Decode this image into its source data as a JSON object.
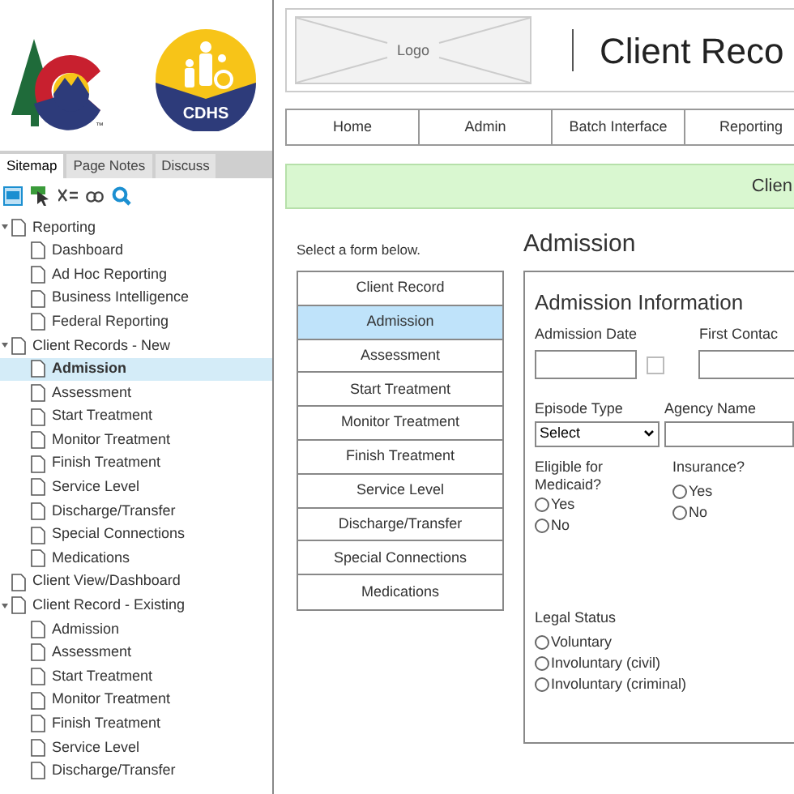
{
  "sidebar": {
    "logo_text": "CDHS",
    "trademark": "™",
    "tabs": [
      {
        "label": "Sitemap",
        "selected": true
      },
      {
        "label": "Page Notes",
        "selected": false
      },
      {
        "label": "Discuss",
        "selected": false
      }
    ],
    "tree": [
      {
        "label": "Reporting",
        "selected": false,
        "expanded": true,
        "children": [
          {
            "label": "Dashboard",
            "selected": false
          },
          {
            "label": "Ad Hoc Reporting",
            "selected": false
          },
          {
            "label": "Business Intelligence",
            "selected": false
          },
          {
            "label": "Federal Reporting",
            "selected": false
          }
        ]
      },
      {
        "label": "Client Records - New",
        "selected": false,
        "expanded": true,
        "children": [
          {
            "label": "Admission",
            "selected": true
          },
          {
            "label": "Assessment",
            "selected": false
          },
          {
            "label": "Start Treatment",
            "selected": false
          },
          {
            "label": "Monitor Treatment",
            "selected": false
          },
          {
            "label": "Finish Treatment",
            "selected": false
          },
          {
            "label": "Service Level",
            "selected": false
          },
          {
            "label": "Discharge/Transfer",
            "selected": false
          },
          {
            "label": "Special Connections",
            "selected": false
          },
          {
            "label": "Medications",
            "selected": false
          }
        ]
      },
      {
        "label": "Client View/Dashboard",
        "selected": false,
        "expanded": false
      },
      {
        "label": "Client Record - Existing",
        "selected": false,
        "expanded": true,
        "children": [
          {
            "label": "Admission",
            "selected": false
          },
          {
            "label": "Assessment",
            "selected": false
          },
          {
            "label": "Start Treatment",
            "selected": false
          },
          {
            "label": "Monitor Treatment",
            "selected": false
          },
          {
            "label": "Finish Treatment",
            "selected": false
          },
          {
            "label": "Service Level",
            "selected": false
          },
          {
            "label": "Discharge/Transfer",
            "selected": false
          }
        ]
      }
    ]
  },
  "header": {
    "logo_placeholder": "Logo",
    "title": "Client Reco"
  },
  "nav": [
    "Home",
    "Admin",
    "Batch Interface",
    "Reporting"
  ],
  "banner": "Clien",
  "form_list": {
    "prompt": "Select a form below.",
    "items": [
      {
        "label": "Client Record",
        "selected": false
      },
      {
        "label": "Admission",
        "selected": true
      },
      {
        "label": "Assessment",
        "selected": false
      },
      {
        "label": "Start Treatment",
        "selected": false
      },
      {
        "label": "Monitor Treatment",
        "selected": false
      },
      {
        "label": "Finish Treatment",
        "selected": false
      },
      {
        "label": "Service Level",
        "selected": false
      },
      {
        "label": "Discharge/Transfer",
        "selected": false
      },
      {
        "label": "Special Connections",
        "selected": false
      },
      {
        "label": "Medications",
        "selected": false
      }
    ]
  },
  "form": {
    "heading": "Admission",
    "section": "Admission Information",
    "admission_date": {
      "label": "Admission Date",
      "checked": false
    },
    "first_contact": {
      "label": "First Contac"
    },
    "episode_type": {
      "label": "Episode Type",
      "value": "Select"
    },
    "agency_name": {
      "label": "Agency Name"
    },
    "medicaid": {
      "label": "Eligible for Medicaid?",
      "options": [
        {
          "label": "Yes",
          "selected": false
        },
        {
          "label": "No",
          "selected": false
        }
      ]
    },
    "insurance": {
      "label": "Insurance?",
      "options": [
        {
          "label": "Yes",
          "selected": false
        },
        {
          "label": "No",
          "selected": false
        }
      ]
    },
    "legal_status": {
      "label": "Legal Status",
      "options": [
        {
          "label": "Voluntary",
          "selected": false
        },
        {
          "label": "Involuntary (civil)",
          "selected": false
        },
        {
          "label": "Involuntary (criminal)",
          "selected": false
        }
      ]
    }
  }
}
